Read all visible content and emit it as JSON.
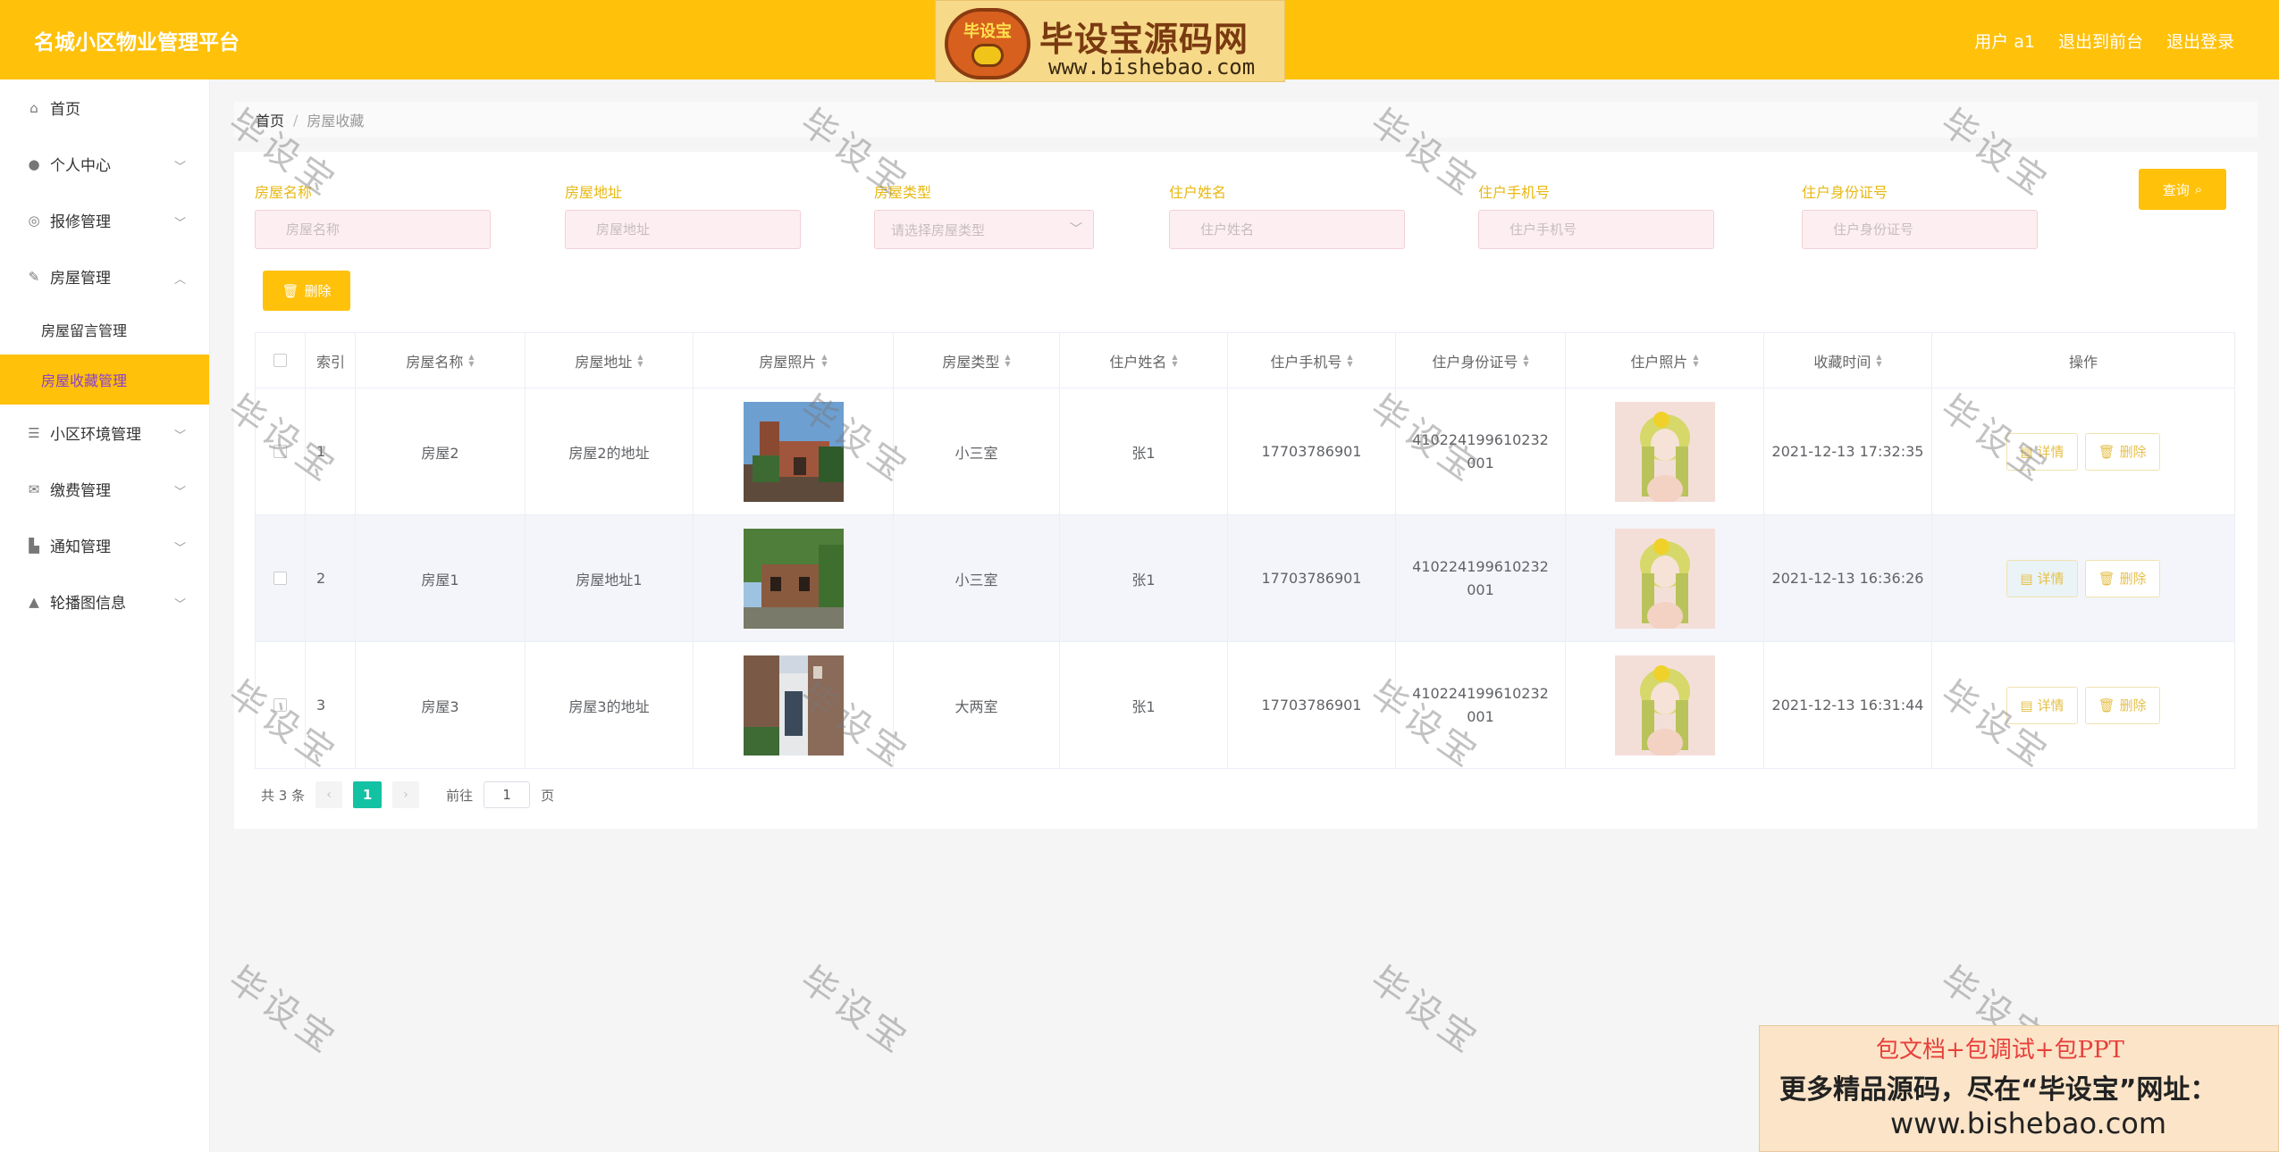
{
  "header": {
    "title": "名城小区物业管理平台",
    "user": "用户 a1",
    "to_front": "退出到前台",
    "logout": "退出登录",
    "bg_color": "#ffc10a"
  },
  "logo": {
    "badge_text": "毕设宝",
    "main_text": "毕设宝源码网",
    "url": "www.bishebao.com"
  },
  "sidebar": {
    "items": [
      {
        "label": "首页",
        "icon": "home-icon"
      },
      {
        "label": "个人中心",
        "icon": "user-icon"
      },
      {
        "label": "报修管理",
        "icon": "repair-icon"
      },
      {
        "label": "房屋管理",
        "icon": "house-icon"
      },
      {
        "label": "小区环境管理",
        "icon": "sliders-icon"
      },
      {
        "label": "缴费管理",
        "icon": "mail-icon"
      },
      {
        "label": "通知管理",
        "icon": "notice-icon"
      },
      {
        "label": "轮播图信息",
        "icon": "carousel-icon"
      }
    ],
    "sub": [
      "房屋留言管理",
      "房屋收藏管理"
    ],
    "active_color": "#ffc10a"
  },
  "breadcrumb": {
    "home": "首页",
    "sep": "/",
    "current": "房屋收藏"
  },
  "filters": {
    "house_name": {
      "label": "房屋名称",
      "placeholder": "房屋名称"
    },
    "house_address": {
      "label": "房屋地址",
      "placeholder": "房屋地址"
    },
    "house_type": {
      "label": "房屋类型",
      "placeholder": "请选择房屋类型"
    },
    "resident_name": {
      "label": "住户姓名",
      "placeholder": "住户姓名"
    },
    "resident_phone": {
      "label": "住户手机号",
      "placeholder": "住户手机号"
    },
    "resident_id": {
      "label": "住户身份证号",
      "placeholder": "住户身份证号"
    },
    "query_label": "查询"
  },
  "delete_label": "删除",
  "table": {
    "columns": [
      "索引",
      "房屋名称",
      "房屋地址",
      "房屋照片",
      "房屋类型",
      "住户姓名",
      "住户手机号",
      "住户身份证号",
      "住户照片",
      "收藏时间",
      "操作"
    ],
    "rows": [
      {
        "index": "1",
        "name": "房屋2",
        "address": "房屋2的地址",
        "type": "小三室",
        "resident": "张1",
        "phone": "17703786901",
        "id_no": "410224199610232001",
        "time": "2021-12-13 17:32:35"
      },
      {
        "index": "2",
        "name": "房屋1",
        "address": "房屋地址1",
        "type": "小三室",
        "resident": "张1",
        "phone": "17703786901",
        "id_no": "410224199610232001",
        "time": "2021-12-13 16:36:26"
      },
      {
        "index": "3",
        "name": "房屋3",
        "address": "房屋3的地址",
        "type": "大两室",
        "resident": "张1",
        "phone": "17703786901",
        "id_no": "410224199610232001",
        "time": "2021-12-13 16:31:44"
      }
    ],
    "detail_label": "详情",
    "delete_label": "删除"
  },
  "pager": {
    "total": "共 3 条",
    "current": "1",
    "goto": "前往",
    "page_value": "1",
    "page_unit": "页",
    "active_color": "#13c2a3"
  },
  "watermark": "毕设宝",
  "promo": {
    "line1": "包文档+包调试+包PPT",
    "line2": "更多精品源码，尽在“毕设宝”网址：",
    "line3": "www.bishebao.com"
  }
}
